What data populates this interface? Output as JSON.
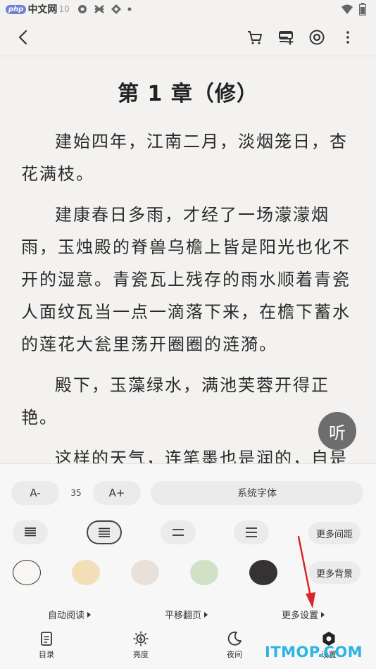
{
  "status_bar": {
    "watermark_php_badge": "php",
    "watermark_php_text": "中文网",
    "time": "10"
  },
  "app_bar": {
    "icons": [
      "back-arrow-icon",
      "cart-icon",
      "add-to-shelf-icon",
      "target-icon",
      "more-vert-icon"
    ]
  },
  "content": {
    "chapter_title": "第 1 章（修）",
    "paragraphs": [
      "建始四年，江南二月，淡烟笼日，杏花满枝。",
      "建康春日多雨，才经了一场濛濛烟雨，玉烛殿的脊兽乌檐上皆是阳光也化不开的湿意。青瓷瓦上残存的雨水顺着青瓷人面纹瓦当一点一滴落下来，在檐下蓄水的莲花大瓮里荡开圈圈的涟漪。",
      "殿下，玉藻绿水，满池芙蓉开得正艳。",
      "这样的天气，连笔墨也是润的，自是"
    ]
  },
  "listen_button": {
    "label": "听"
  },
  "settings": {
    "font_decrease_label": "A-",
    "font_size_value": "35",
    "font_increase_label": "A+",
    "font_family_label": "系统字体",
    "more_spacing_label": "更多间距",
    "more_background_label": "更多背景",
    "background_colors": [
      "#f7f6f3",
      "#f2dfb7",
      "#e9e1d9",
      "#d1e1c5",
      "#353233"
    ],
    "options": {
      "auto_read": "自动阅读",
      "page_turn": "平移翻页",
      "more_settings": "更多设置"
    }
  },
  "tab_bar": {
    "catalog": "目录",
    "brightness": "亮度",
    "night": "夜间",
    "settings": "设置"
  },
  "watermark_itmop": "ITMOP.COM",
  "annotation_color": "#d9262a"
}
